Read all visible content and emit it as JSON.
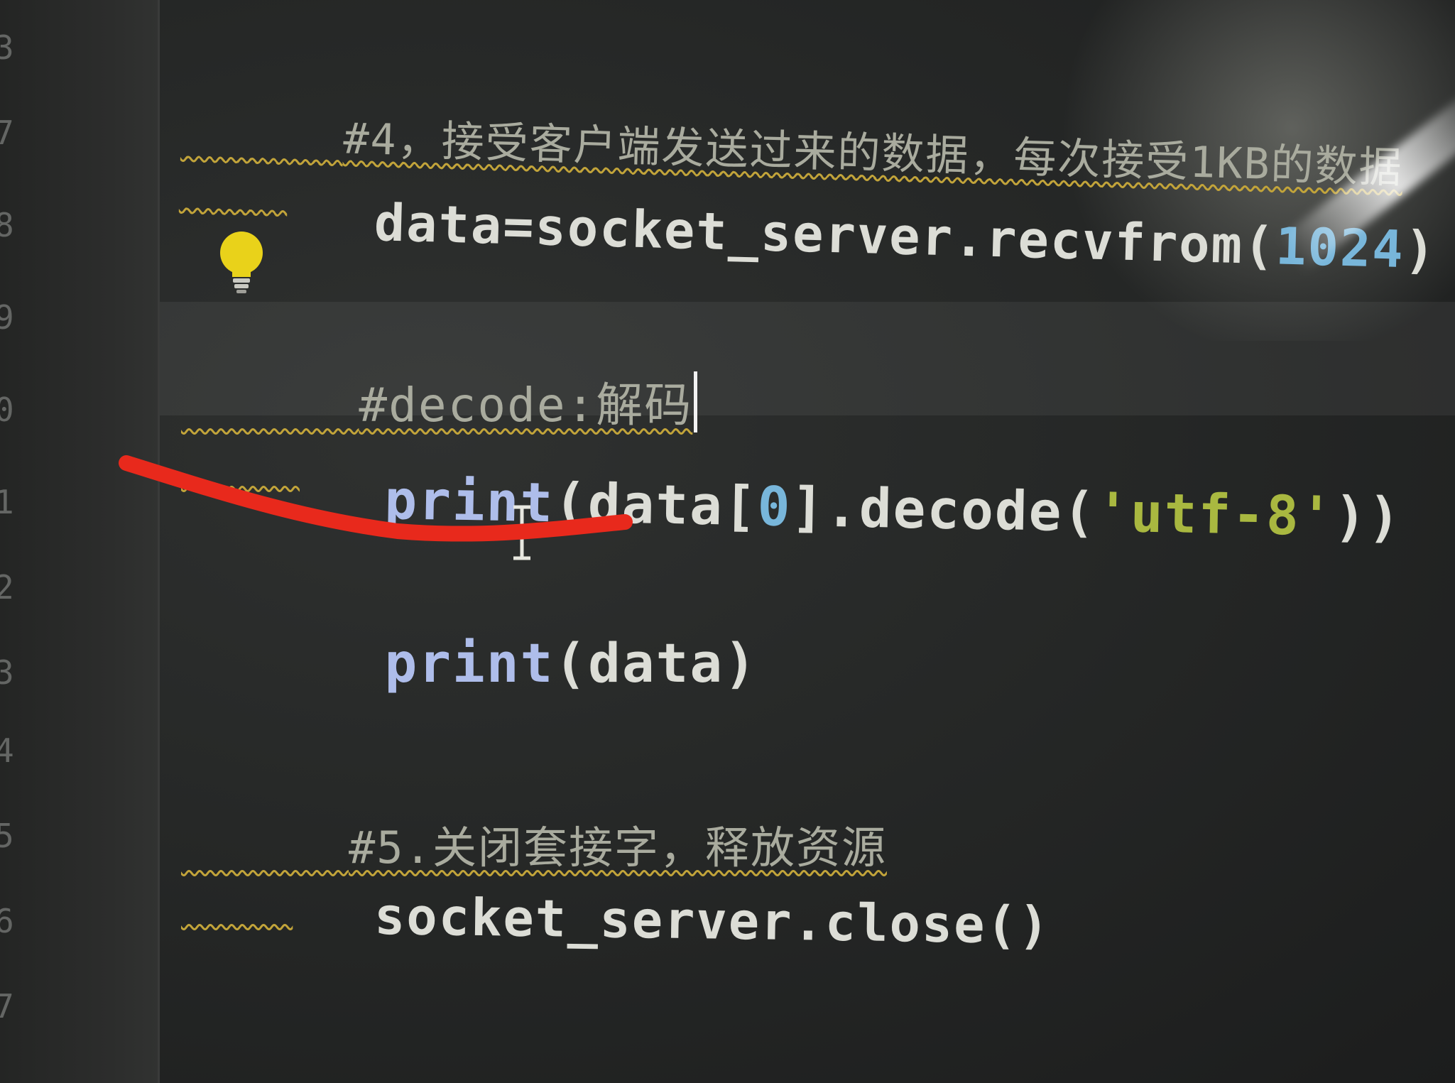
{
  "gutter": {
    "numbers": [
      "3",
      "7",
      "8",
      "9",
      "0",
      "1",
      "2",
      "3",
      "4",
      "5",
      "6",
      "7"
    ]
  },
  "editor": {
    "lines": {
      "comment_receive": "#4，接受客户端发送过来的数据，每次接受1KB的数据",
      "recv_var": "data",
      "recv_eq": "=",
      "recv_obj": "socket_server.recvfrom(",
      "recv_num": "1024",
      "recv_close": ")",
      "comment_decode": "#decode:解码",
      "print1_kw": "print",
      "print1_a": "(data[",
      "print1_idx": "0",
      "print1_b": "].decode(",
      "print1_str": "'utf-8'",
      "print1_c": "))",
      "print2_kw": "print",
      "print2_a": "(data)",
      "comment_close": "#5.关闭套接字，释放资源",
      "close_stmt": "socket_server.close()"
    }
  },
  "colors": {
    "comment": "#a9ab9e",
    "keyword": "#aebdea",
    "number": "#78b6da",
    "string": "#a9b840",
    "annotation": "#e8291c"
  },
  "icons": {
    "intention": "lightbulb-icon",
    "cursor": "text-cursor-icon"
  }
}
